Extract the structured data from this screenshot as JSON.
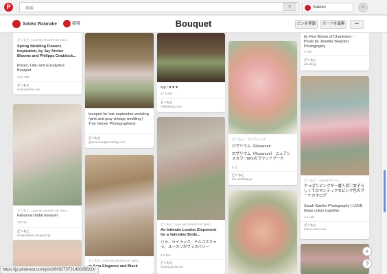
{
  "topbar": {
    "logo": "P",
    "search_placeholder": "検索",
    "menu_icon": "≡",
    "user_name": "Satoko",
    "chat_icon": "☺"
  },
  "board": {
    "owner": "Satoko Watanabe",
    "invite": "招待",
    "title": "Bouquet",
    "move_pins": "ピンを移動",
    "edit_board": "ボードを編集",
    "more": "•••"
  },
  "pins": [
    {
      "source": "ピンもと: Love My Dress® UK Wed...",
      "title": "Spring Wedding Flowers Inspiration, by Jay Archer Blooms and Philippa Craddock...",
      "desc": "Roses, Lilac and Eucalyptus Bouquet",
      "stats": "14  2  782",
      "saved_by": "ピンもと",
      "host": "lovemydress.net"
    },
    {
      "title": "bouquet for late september wedding (pink and gray vintage wedding | Troy Grover Photographers)",
      "saved_by": "ピンもと",
      "host": "glamourandgraceblog.com"
    },
    {
      "title": "top ! ♥ ♥ ♥",
      "stats": "47  8  244",
      "saved_by": "ピンもと",
      "host": "ruffledblog.com"
    },
    {
      "source": "ピンもと：ウエディング",
      "title": "ロザリウム（Rosarium",
      "desc": "ロザリウム（Rosarium） ニュアンスカラーMIXのラウンドブーケ",
      "stats": "5  41",
      "saved_by": "ピンもと",
      "host": "the-wedding.jp"
    },
    {
      "title": "by First Bloom of Charleston - Photo by Jennifer Beardon Photography",
      "stats": "2  780",
      "saved_by": "ピンもと",
      "host": "amelie.jp"
    },
    {
      "source": "ピンもと: Love My Dress® UK Wed...",
      "title": "Fabulous bridal bouquet",
      "stats": "127  15",
      "saved_by": "ピンもと",
      "host": "ilovjackalahc.blogspot.jp"
    },
    {
      "source": "ピンもと: Love My Dress® UK Wed...",
      "title": "An Intimate London Elopement for a Valentine Bride...",
      "desc": "バラ、ライラック、ドルコホキャラ、ユーカリがブラスベリー",
      "stats": "6  2  112",
      "saved_by": "ピンもと",
      "host": "lovemydress.net"
    },
    {
      "source": "ピンもと：marry(マリー) ...",
      "title": "やっぱりピンクが一番人気♡女子らしくてロマンテックなピンク色のブーケカタログ",
      "desc": "Sarah Gawler Photography | LOVE these colors together",
      "stats": "1  2  118",
      "saved_by": "ピンもと",
      "host": "marry-xoxo.com"
    },
    {
      "source": "ピンもと: Love My Dress® UK Wed...",
      "title": "m Acra Elegance and Black"
    }
  ],
  "ui": {
    "add_icon": "+",
    "help_icon": "?",
    "status_url": "https://jp.pinterest.com/pin/26092737214002881O/"
  },
  "colors": {
    "brand": "#cb2027",
    "scroll_thumb": "#6b8ed6"
  }
}
